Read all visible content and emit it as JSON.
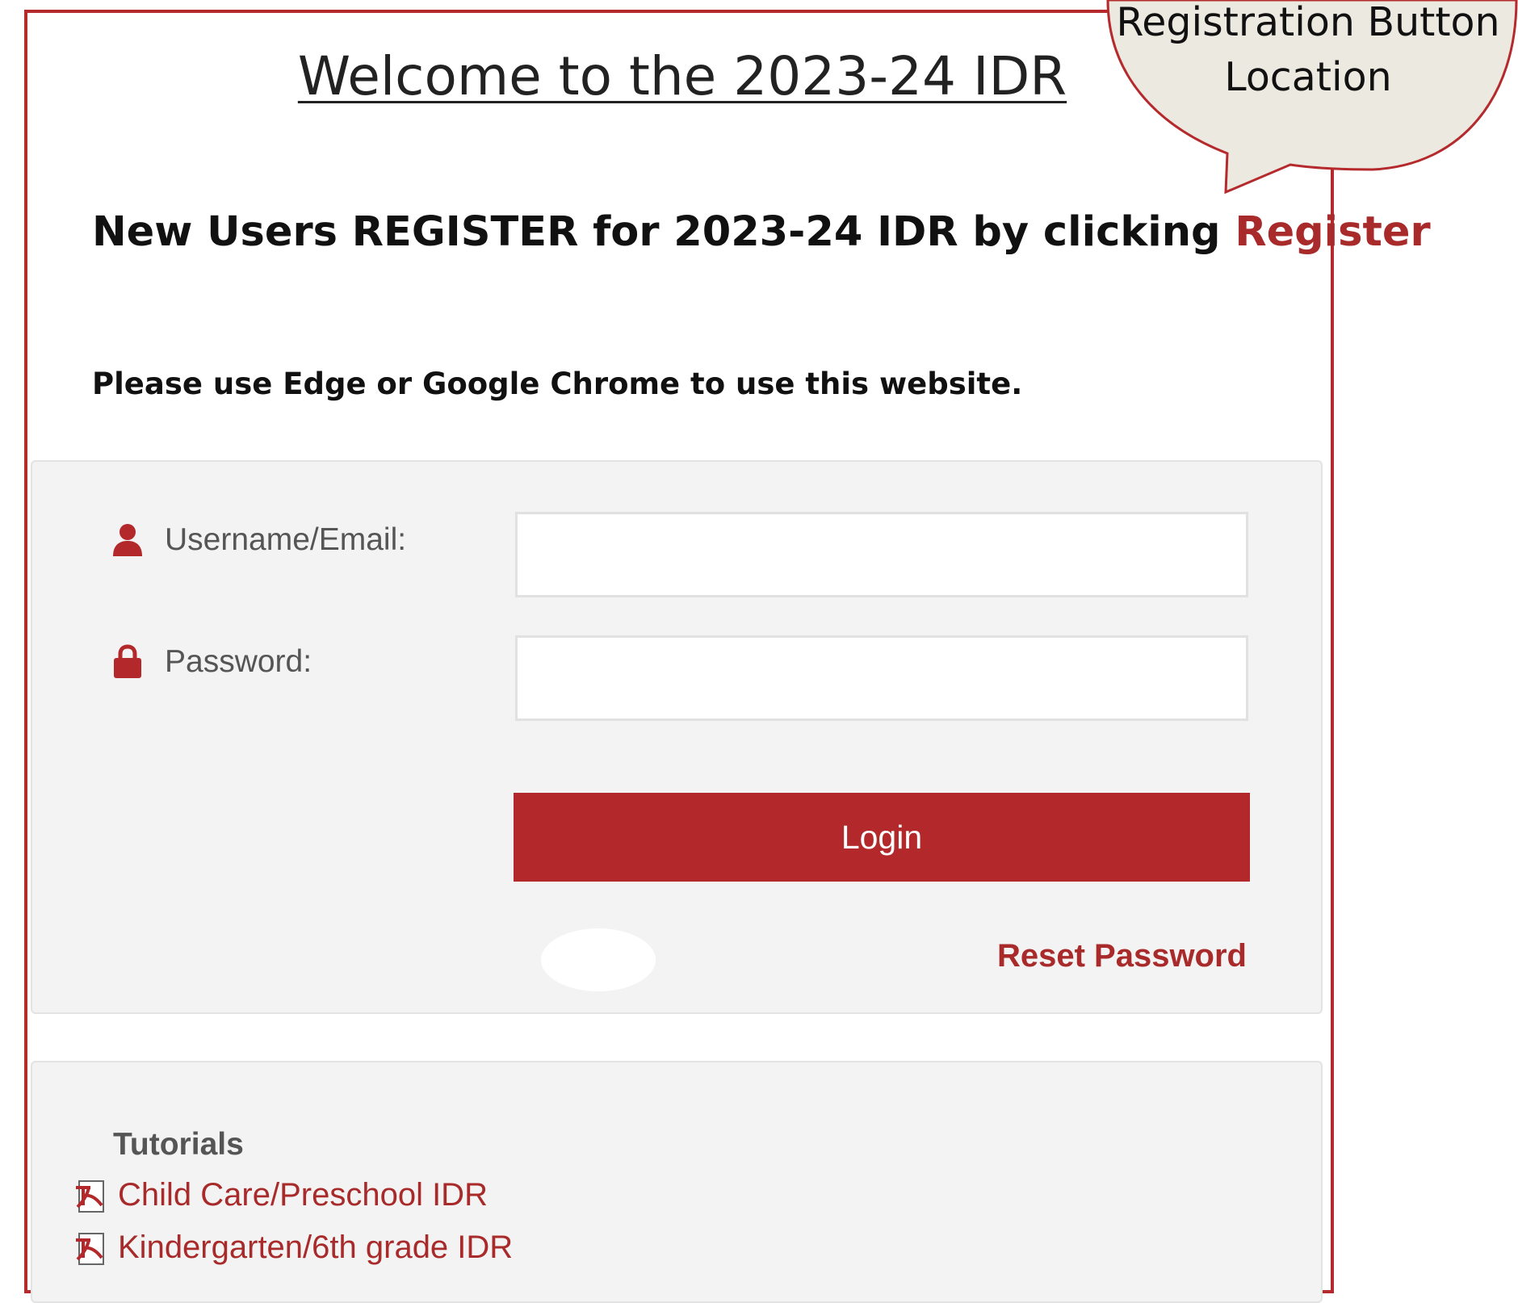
{
  "header": {
    "welcome_title": "Welcome to the 2023-24 IDR",
    "register_prefix": "New Users REGISTER for 2023-24 IDR by clicking ",
    "register_link": "Register",
    "browser_note": "Please use Edge or Google Chrome to use this website."
  },
  "login_form": {
    "username_label": "Username/Email:",
    "username_value": "",
    "password_label": "Password:",
    "password_value": "",
    "login_button": "Login",
    "reset_password": "Reset Password"
  },
  "tutorials": {
    "heading": "Tutorials",
    "links": [
      {
        "label": "Child Care/Preschool IDR",
        "icon": "pdf-icon"
      },
      {
        "label": "Kindergarten/6th grade IDR",
        "icon": "pdf-icon"
      }
    ]
  },
  "annotation": {
    "callout_line1": "Registration Button",
    "callout_line2": "Location"
  },
  "colors": {
    "accent_red": "#b3282a",
    "link_red": "#a82a2a",
    "panel_gray": "#f3f3f3",
    "callout_fill": "#ece9e1"
  },
  "icons": [
    "user-icon",
    "lock-icon",
    "pdf-icon"
  ]
}
